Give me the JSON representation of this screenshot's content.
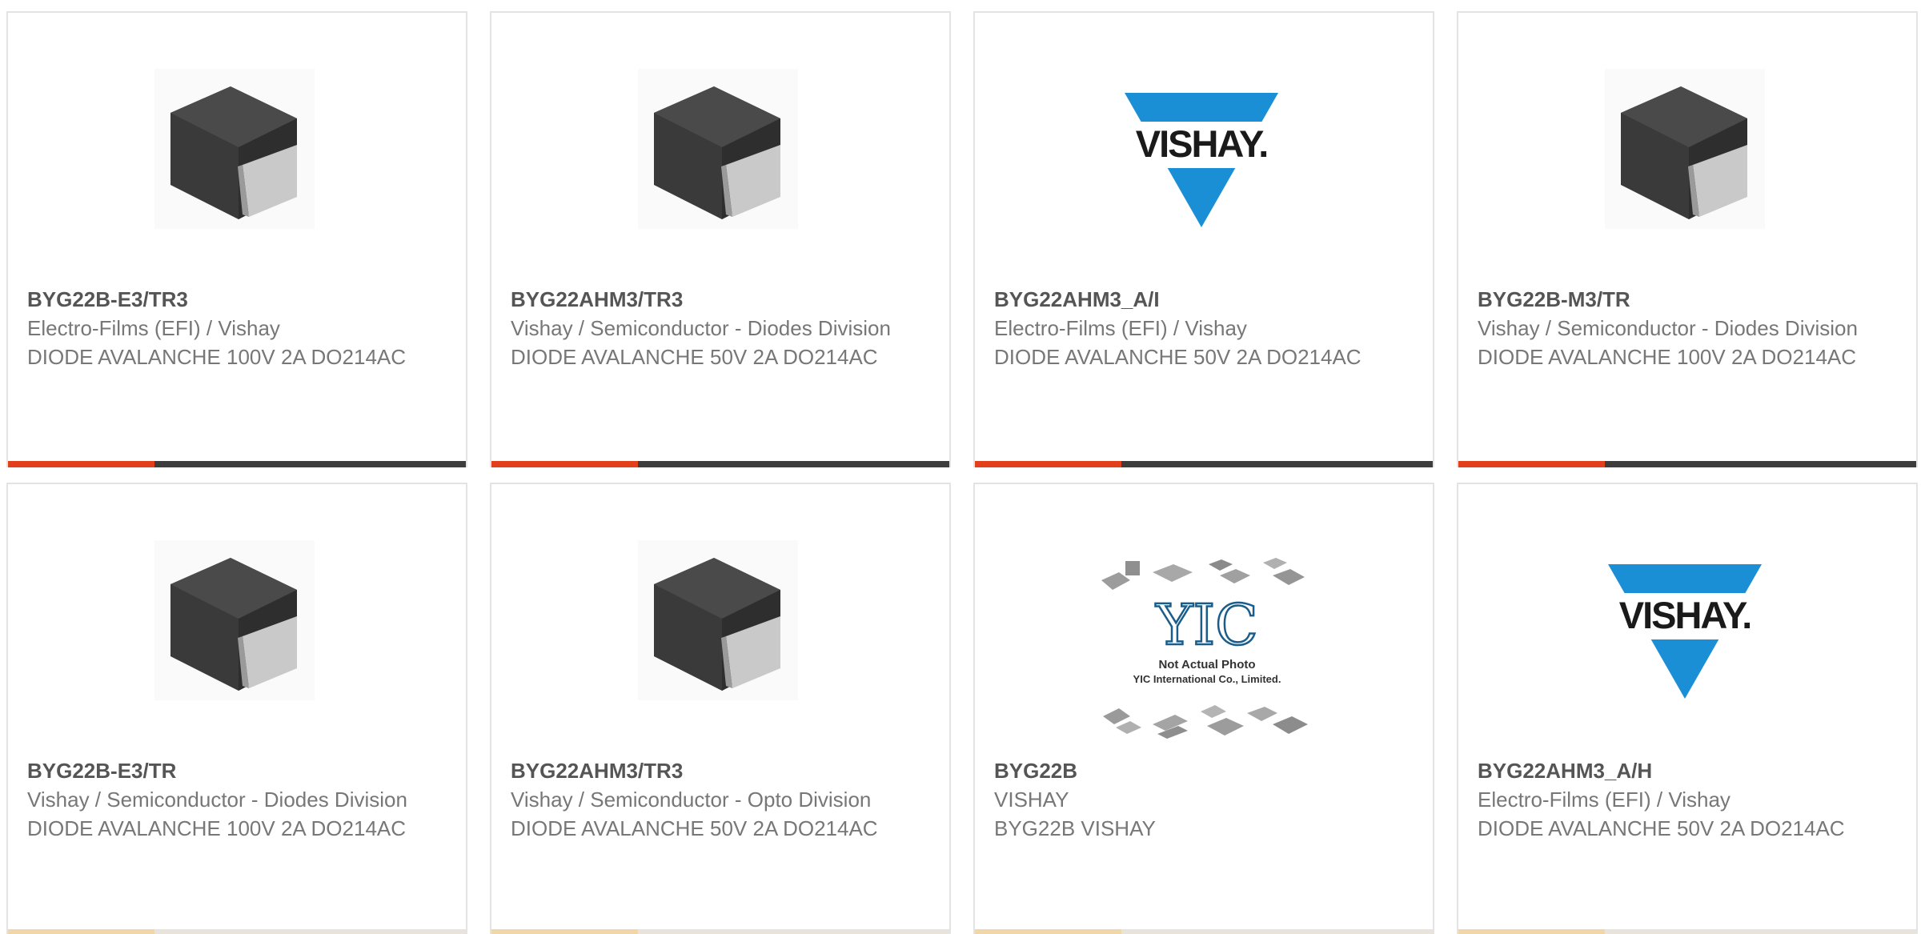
{
  "colors": {
    "accent": "#e2401c",
    "bar_dark": "#3d3d3d",
    "vishay_blue": "#1b8fd6",
    "text_gray": "#777777"
  },
  "cards": [
    {
      "part": "BYG22B-E3/TR3",
      "manufacturer": "Electro-Films (EFI) / Vishay",
      "description": "DIODE AVALANCHE 100V 2A DO214AC",
      "image": "smd-diode-package",
      "progress": 0.32
    },
    {
      "part": "BYG22AHM3/TR3",
      "manufacturer": "Vishay / Semiconductor - Diodes Division",
      "description": "DIODE AVALANCHE 50V 2A DO214AC",
      "image": "smd-diode-package",
      "progress": 0.32
    },
    {
      "part": "BYG22AHM3_A/I",
      "manufacturer": "Electro-Films (EFI) / Vishay",
      "description": "DIODE AVALANCHE 50V 2A DO214AC",
      "image": "vishay-logo",
      "logo_text": "VISHAY.",
      "progress": 0.32
    },
    {
      "part": "BYG22B-M3/TR",
      "manufacturer": "Vishay / Semiconductor - Diodes Division",
      "description": "DIODE AVALANCHE 100V 2A DO214AC",
      "image": "smd-diode-package",
      "progress": 0.32
    },
    {
      "part": "BYG22B-E3/TR",
      "manufacturer": "Vishay / Semiconductor - Diodes Division",
      "description": "DIODE AVALANCHE 100V 2A DO214AC",
      "image": "smd-diode-package",
      "progress": 0.32
    },
    {
      "part": "BYG22AHM3/TR3",
      "manufacturer": "Vishay / Semiconductor - Opto Division",
      "description": "DIODE AVALANCHE 50V 2A DO214AC",
      "image": "smd-diode-package",
      "progress": 0.32
    },
    {
      "part": "BYG22B",
      "manufacturer": "VISHAY",
      "description": "BYG22B VISHAY",
      "image": "yic-placeholder",
      "logo_text": "YIC",
      "caption_line1": "Not Actual Photo",
      "caption_line2": "YIC International Co., Limited.",
      "progress": 0.32
    },
    {
      "part": "BYG22AHM3_A/H",
      "manufacturer": "Electro-Films (EFI) / Vishay",
      "description": "DIODE AVALANCHE 50V 2A DO214AC",
      "image": "vishay-logo",
      "logo_text": "VISHAY.",
      "progress": 0.32
    }
  ]
}
